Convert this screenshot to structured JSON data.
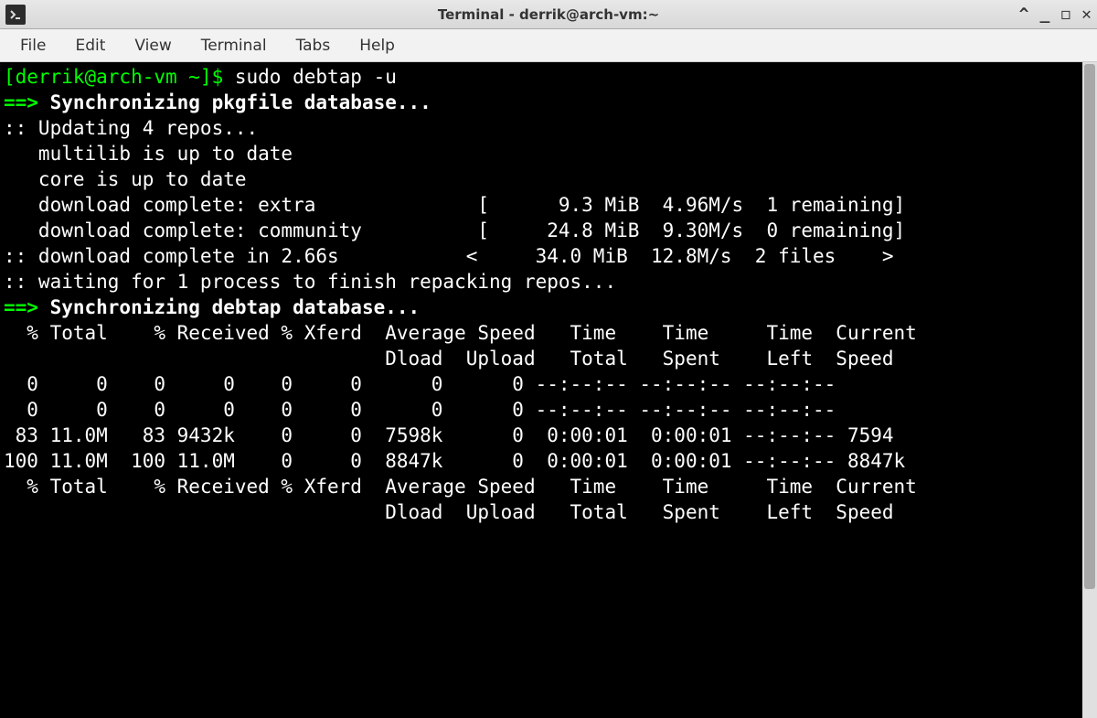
{
  "window": {
    "title": "Terminal - derrik@arch-vm:~"
  },
  "menu": {
    "file": "File",
    "edit": "Edit",
    "view": "View",
    "terminal": "Terminal",
    "tabs": "Tabs",
    "help": "Help"
  },
  "prompt": {
    "user_host": "[derrik@arch-vm ~]$ ",
    "command": "sudo debtap -u"
  },
  "sync_pkgfile": {
    "arrow": "==> ",
    "msg": "Synchronizing pkgfile database..."
  },
  "updating": ":: Updating 4 repos...",
  "multilib": "   multilib is up to date",
  "core": "   core is up to date",
  "dl_extra": "   download complete: extra              [      9.3 MiB  4.96M/s  1 remaining]",
  "dl_community": "   download complete: community          [     24.8 MiB  9.30M/s  0 remaining]",
  "dl_complete": ":: download complete in 2.66s           <     34.0 MiB  12.8M/s  2 files    >",
  "waiting": ":: waiting for 1 process to finish repacking repos...",
  "sync_debtap": {
    "arrow": "==> ",
    "msg": "Synchronizing debtap database..."
  },
  "curl_header1": "  % Total    % Received % Xferd  Average Speed   Time    Time     Time  Current",
  "curl_header2": "                                 Dload  Upload   Total   Spent    Left  Speed",
  "curl_row1": "  0     0    0     0    0     0      0      0 --:--:-- --:--:-- --:--:--",
  "curl_row2": "  0     0    0     0    0     0      0      0 --:--:-- --:--:-- --:--:--",
  "curl_row3": " 83 11.0M   83 9432k    0     0  7598k      0  0:00:01  0:00:01 --:--:-- 7594",
  "curl_row4": "100 11.0M  100 11.0M    0     0  8847k      0  0:00:01  0:00:01 --:--:-- 8847k",
  "curl_header3": "  % Total    % Received % Xferd  Average Speed   Time    Time     Time  Current",
  "curl_header4": "                                 Dload  Upload   Total   Spent    Left  Speed"
}
